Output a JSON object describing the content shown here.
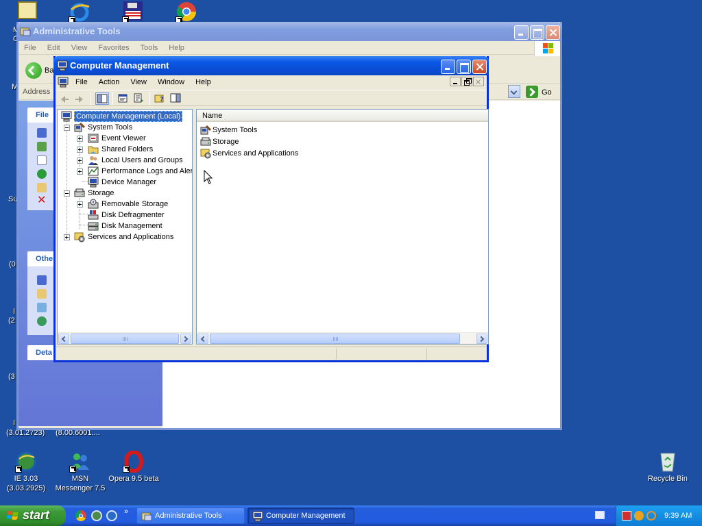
{
  "desktop": {
    "top_icons": [
      "",
      "",
      "",
      ""
    ],
    "edge_labels": {
      "m1": "M",
      "c1": "C",
      "m2": "M",
      "su": "Su",
      "o1": "(0",
      "i1": "I",
      "two": "(2",
      "three": "(3",
      "i2": "I"
    },
    "bottom_left_labels": {
      "a": "(3.01.2723)",
      "b": "(8.00.6001...."
    },
    "icons": [
      {
        "label": "IE 3.03\n(3.03.2925)",
        "icon": "ie-icon"
      },
      {
        "label": "MSN\nMessenger 7.5",
        "icon": "msn-messenger-icon"
      },
      {
        "label": "Opera 9.5 beta",
        "icon": "opera-icon"
      },
      {
        "label": "Recycle Bin",
        "icon": "recycle-bin-icon"
      }
    ]
  },
  "admin_window": {
    "title": "Administrative Tools",
    "menu": [
      "File",
      "Edit",
      "View",
      "Favorites",
      "Tools",
      "Help"
    ],
    "back_label": "Ba",
    "address_label": "Address",
    "go_label": "Go",
    "taskpane": {
      "file_head": "File",
      "other_head": "Othe",
      "details_head": "Deta"
    }
  },
  "cm_window": {
    "title": "Computer Management",
    "menu": [
      "File",
      "Action",
      "View",
      "Window",
      "Help"
    ],
    "tree": [
      {
        "label": "Computer Management (Local)",
        "icon": "computer-management-icon",
        "selected": true
      },
      {
        "label": "System Tools",
        "icon": "system-tools-icon"
      },
      {
        "label": "Event Viewer",
        "icon": "event-viewer-icon"
      },
      {
        "label": "Shared Folders",
        "icon": "shared-folders-icon"
      },
      {
        "label": "Local Users and Groups",
        "icon": "local-users-icon"
      },
      {
        "label": "Performance Logs and Alerts",
        "icon": "performance-logs-icon"
      },
      {
        "label": "Device Manager",
        "icon": "device-manager-icon"
      },
      {
        "label": "Storage",
        "icon": "storage-icon"
      },
      {
        "label": "Removable Storage",
        "icon": "removable-storage-icon"
      },
      {
        "label": "Disk Defragmenter",
        "icon": "disk-defragmenter-icon"
      },
      {
        "label": "Disk Management",
        "icon": "disk-management-icon"
      },
      {
        "label": "Services and Applications",
        "icon": "services-applications-icon"
      }
    ],
    "list_header": "Name",
    "list_items": [
      {
        "label": "System Tools",
        "icon": "system-tools-icon"
      },
      {
        "label": "Storage",
        "icon": "storage-icon"
      },
      {
        "label": "Services and Applications",
        "icon": "services-applications-icon"
      }
    ]
  },
  "taskbar": {
    "start_label": "start",
    "tasks": [
      {
        "label": "Administrative Tools",
        "pressed": false
      },
      {
        "label": "Computer Management",
        "pressed": true
      }
    ],
    "quick_launch_more": "»",
    "clock": "9:39 AM"
  },
  "colors": {
    "desktop": "#1d4fa3",
    "titlebar_active": "#0a58e6",
    "selection": "#316ac5"
  }
}
